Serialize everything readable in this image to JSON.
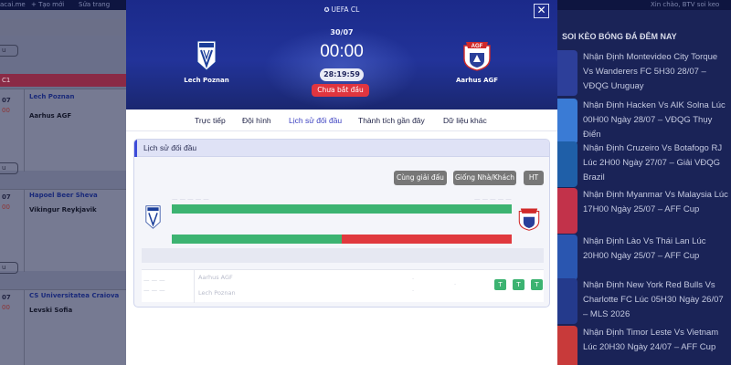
{
  "background": {
    "topbar": [
      "acai.me",
      "+ Tạo mới",
      "Sửa trang",
      "Xin chào, BTV soi keo"
    ],
    "left": {
      "partial_buttons": [
        "u",
        "u",
        "u"
      ],
      "section_label": "C1",
      "matches": [
        {
          "date": "07",
          "time": "00",
          "home": "Lech Poznan",
          "away": "Aarhus AGF"
        },
        {
          "date": "07",
          "time": "00",
          "home": "Hapoel Beer Sheva",
          "away": "Vikingur Reykjavik"
        },
        {
          "date": "07",
          "time": "00",
          "home": "CS Universitatea Craiova",
          "away": "Levski Sofia"
        }
      ]
    },
    "right": {
      "heading": "SOI KÈO BÓNG ĐÁ ĐÊM NAY",
      "news": [
        "Nhận Định Montevideo City Torque Vs Wanderers FC 5H30 28/07 – VĐQG Uruguay",
        "Nhận Định Hacken Vs AIK Solna Lúc 00H00 Ngày 28/07 – VĐQG Thụy Điển",
        "Nhận Định Cruzeiro Vs Botafogo RJ Lúc 2H00 Ngày 27/07 – Giải VĐQG Brazil",
        "Nhận Định Myanmar Vs Malaysia Lúc 17H00 Ngày 25/07 – AFF Cup",
        "Nhận Định Lào Vs Thái Lan Lúc 20H00 Ngày 25/07 – AFF Cup",
        "Nhận Định New York Red Bulls Vs Charlotte FC Lúc 05H30 Ngày 26/07 – MLS 2026",
        "Nhận Định Timor Leste Vs Vietnam Lúc 20H30 Ngày 24/07 – AFF Cup"
      ],
      "thumb_colors": [
        "#2d3f9a",
        "#3a7bd5",
        "#1f5fa8",
        "#c2324a",
        "#2a56b0",
        "#243a8c",
        "#c83a3a"
      ]
    }
  },
  "modal": {
    "competition": "UEFA CL",
    "date": "30/07",
    "score": "00:00",
    "countdown": "28:19:59",
    "status": "Chưa bắt đầu",
    "home_team": "Lech Poznan",
    "away_team": "Aarhus AGF",
    "close_icon": "✕",
    "tabs": [
      {
        "label": "Trực tiếp",
        "active": false
      },
      {
        "label": "Đội hình",
        "active": false
      },
      {
        "label": "Lịch sử đối đầu",
        "active": true
      },
      {
        "label": "Thành tích gần đây",
        "active": false
      },
      {
        "label": "Dữ liệu khác",
        "active": false
      }
    ],
    "h2h": {
      "title": "Lịch sử đối đầu",
      "filters": [
        "Cùng giải đấu",
        "Giống Nhà/Khách",
        "HT"
      ],
      "bar1_green_fraction": 1.0,
      "bar2_green_fraction": 0.5,
      "history": [
        {
          "home": "Aarhus AGF",
          "away": "Lech Poznan",
          "results": [
            "T",
            "T",
            "T"
          ]
        }
      ]
    },
    "colors": {
      "win": "#3cb371",
      "loss": "#e0393e",
      "status": "#e0353f",
      "header": "#223399"
    }
  }
}
